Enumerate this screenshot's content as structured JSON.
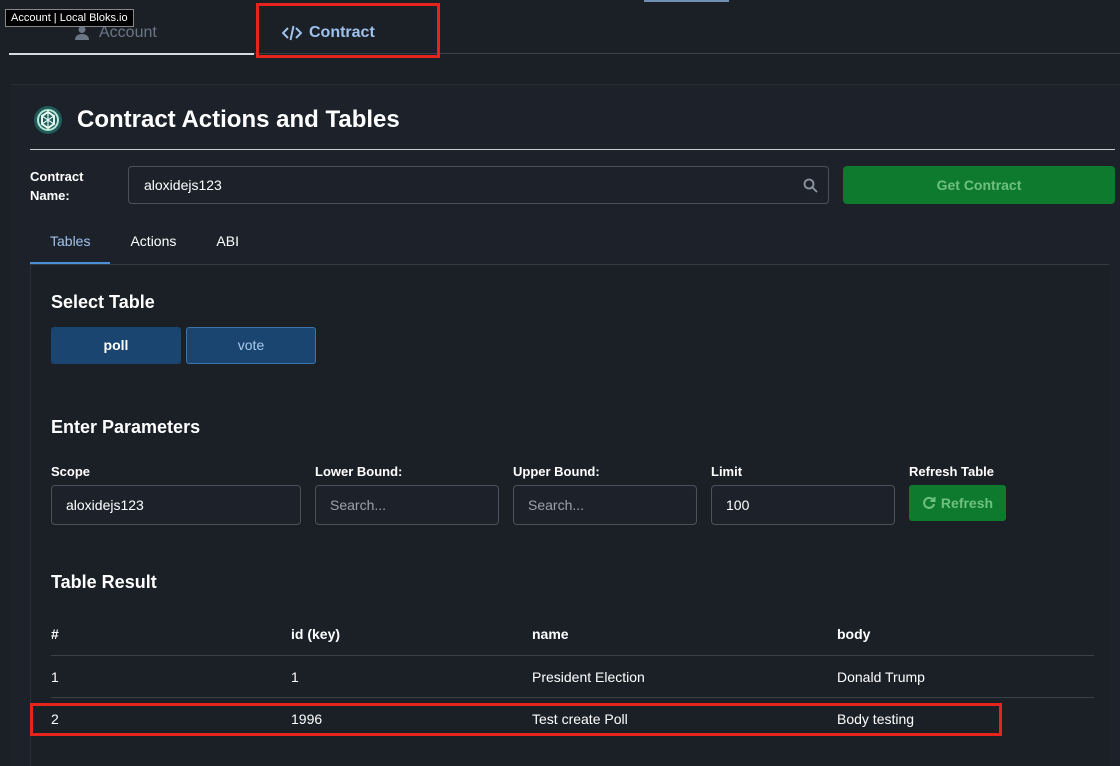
{
  "tooltip": "Account | Local Bloks.io",
  "top_tabs": {
    "account": "Account",
    "contract": "Contract"
  },
  "panel": {
    "title": "Contract Actions and Tables"
  },
  "contract": {
    "label": "Contract Name:",
    "value": "aloxidejs123",
    "get_button": "Get Contract"
  },
  "sub_tabs": [
    "Tables",
    "Actions",
    "ABI"
  ],
  "select_table": {
    "heading": "Select Table",
    "tables": [
      "poll",
      "vote"
    ],
    "selected": "poll"
  },
  "parameters": {
    "heading": "Enter Parameters",
    "scope": {
      "label": "Scope",
      "value": "aloxidejs123"
    },
    "lower": {
      "label": "Lower Bound:",
      "placeholder": "Search..."
    },
    "upper": {
      "label": "Upper Bound:",
      "placeholder": "Search..."
    },
    "limit": {
      "label": "Limit",
      "value": "100"
    },
    "refresh": {
      "label": "Refresh Table",
      "button": "Refresh"
    }
  },
  "result": {
    "heading": "Table Result",
    "columns": [
      "#",
      "id (key)",
      "name",
      "body"
    ],
    "rows": [
      [
        "1",
        "1",
        "President Election",
        "Donald Trump"
      ],
      [
        "2",
        "1996",
        "Test create Poll",
        "Body testing"
      ]
    ]
  },
  "colors": {
    "accent_blue": "#9ec2ee",
    "success_green": "#0e7a2e",
    "highlight_red": "#e6231d",
    "background": "#1b2027"
  }
}
